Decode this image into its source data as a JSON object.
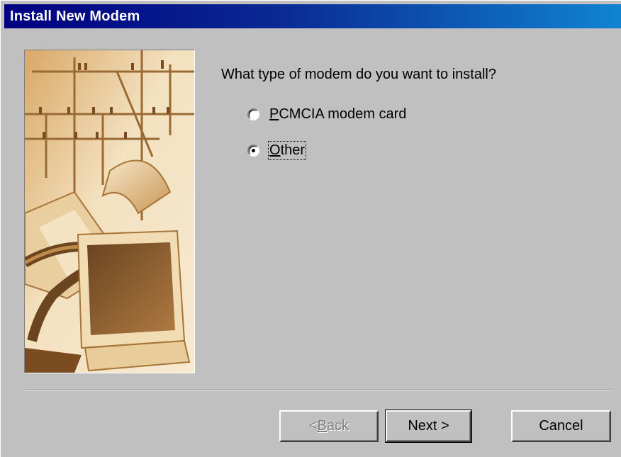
{
  "window": {
    "title": "Install New Modem"
  },
  "wizard": {
    "prompt": "What type of modem do you want to install?",
    "options": [
      {
        "pre": "",
        "accel": "P",
        "post": "CMCIA modem card",
        "selected": false
      },
      {
        "pre": "",
        "accel": "O",
        "post": "ther",
        "selected": true
      }
    ]
  },
  "buttons": {
    "back": {
      "pre": "< ",
      "accel": "B",
      "post": "ack",
      "enabled": false
    },
    "next": {
      "label": "Next >"
    },
    "cancel": {
      "label": "Cancel"
    }
  },
  "illustration": {
    "icon": "modem-computer-illustration",
    "colors": {
      "light": "#f3e1bf",
      "mid": "#d9a866",
      "dark": "#8a5a28"
    }
  }
}
